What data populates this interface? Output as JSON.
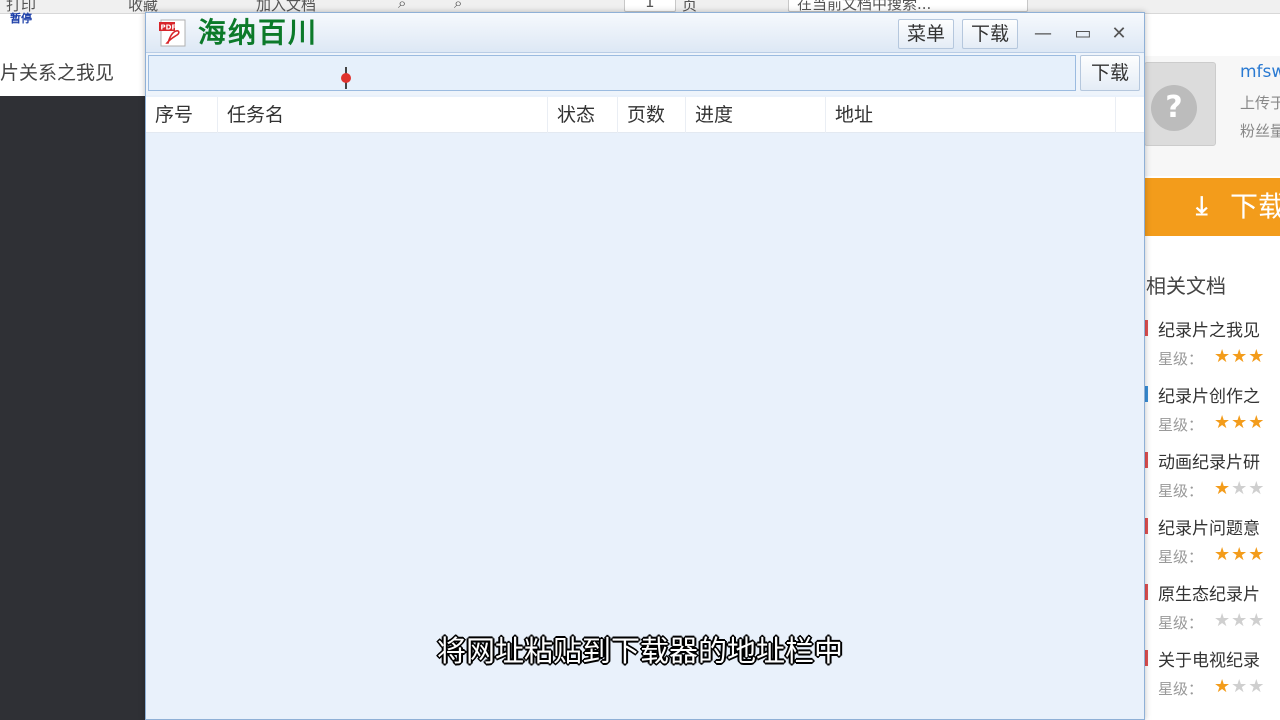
{
  "background": {
    "toolbar_items": [
      "打印",
      "收藏",
      "加入文档",
      "1",
      "页",
      "在当前文档中搜索..."
    ],
    "pause_label": "暂停",
    "breadcrumb": "片关系之我见",
    "uploader": {
      "name": "mfsw",
      "upload_label": "上传于",
      "fans_label": "粉丝量"
    },
    "download_button_label": "下载",
    "related_heading": "相关文档",
    "rating_label": "星级：",
    "related_docs": [
      {
        "title": "纪录片之我见",
        "stars": 3,
        "mark_color": "#e05050"
      },
      {
        "title": "纪录片创作之",
        "stars": 3,
        "mark_color": "#3a8fd8"
      },
      {
        "title": "动画纪录片研",
        "stars": 1,
        "mark_color": "#e05050"
      },
      {
        "title": "纪录片问题意",
        "stars": 3,
        "mark_color": "#e05050"
      },
      {
        "title": "原生态纪录片",
        "stars": 0,
        "mark_color": "#e05050"
      },
      {
        "title": "关于电视纪录",
        "stars": 1,
        "mark_color": "#e05050"
      }
    ]
  },
  "app": {
    "title": "海纳百川",
    "menu_label": "菜单",
    "download_label": "下载",
    "minimize_glyph": "—",
    "maximize_glyph": "▭",
    "close_glyph": "✕",
    "url_value": "",
    "url_placeholder": "",
    "url_download_label": "下载",
    "columns": [
      "序号",
      "任务名",
      "状态",
      "页数",
      "进度",
      "地址"
    ],
    "rows": []
  },
  "subtitle": "将网址粘贴到下载器的地址栏中",
  "colors": {
    "title_green": "#0c7a2a",
    "download_orange": "#f39c1b",
    "star_on": "#f39c1b",
    "window_bg": "#e9f1fb"
  }
}
